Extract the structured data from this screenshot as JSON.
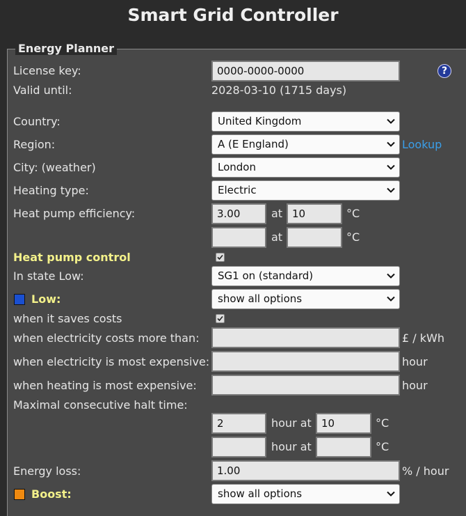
{
  "app": {
    "title": "Smart Grid Controller"
  },
  "section": {
    "legend": "Energy Planner"
  },
  "license": {
    "label": "License key:",
    "value": "0000-0000-0000"
  },
  "valid": {
    "label": "Valid until:",
    "value": "2028-03-10 (1715 days)"
  },
  "country": {
    "label": "Country:",
    "value": "United Kingdom"
  },
  "region": {
    "label": "Region:",
    "value": "A (E England)",
    "link": "Lookup"
  },
  "city": {
    "label": "City: (weather)",
    "value": "London"
  },
  "heating": {
    "label": "Heating type:",
    "value": "Electric"
  },
  "efficiency": {
    "label": "Heat pump efficiency:",
    "row1": {
      "value": "3.00",
      "at": "at",
      "temp": "10",
      "unit": "°C"
    },
    "row2": {
      "value": "",
      "at": "at",
      "temp": "",
      "unit": "°C"
    }
  },
  "hp_control": {
    "label": "Heat pump control",
    "checked": true
  },
  "state_low": {
    "label": "In state Low:",
    "value": "SG1 on (standard)"
  },
  "low": {
    "label": "Low:",
    "value": "show all options",
    "color": "#1a4fd0"
  },
  "saves_costs": {
    "label": "when it saves costs",
    "checked": true
  },
  "cost_more": {
    "label": "when electricity costs more than:",
    "value": "",
    "unit": "£ / kWh"
  },
  "most_expensive": {
    "label": "when electricity is most expensive:",
    "value": "",
    "unit": "hour"
  },
  "heating_expensive": {
    "label": "when heating is most expensive:",
    "value": "",
    "unit": "hour"
  },
  "halt": {
    "label": "Maximal consecutive halt time:",
    "row1": {
      "value": "2",
      "mid": "hour at",
      "temp": "10",
      "unit": "°C"
    },
    "row2": {
      "value": "",
      "mid": "hour at",
      "temp": "",
      "unit": "°C"
    }
  },
  "energy_loss": {
    "label": "Energy loss:",
    "value": "1.00",
    "unit": "% / hour"
  },
  "boost": {
    "label": "Boost:",
    "value": "show all options",
    "color": "#f08a10"
  }
}
